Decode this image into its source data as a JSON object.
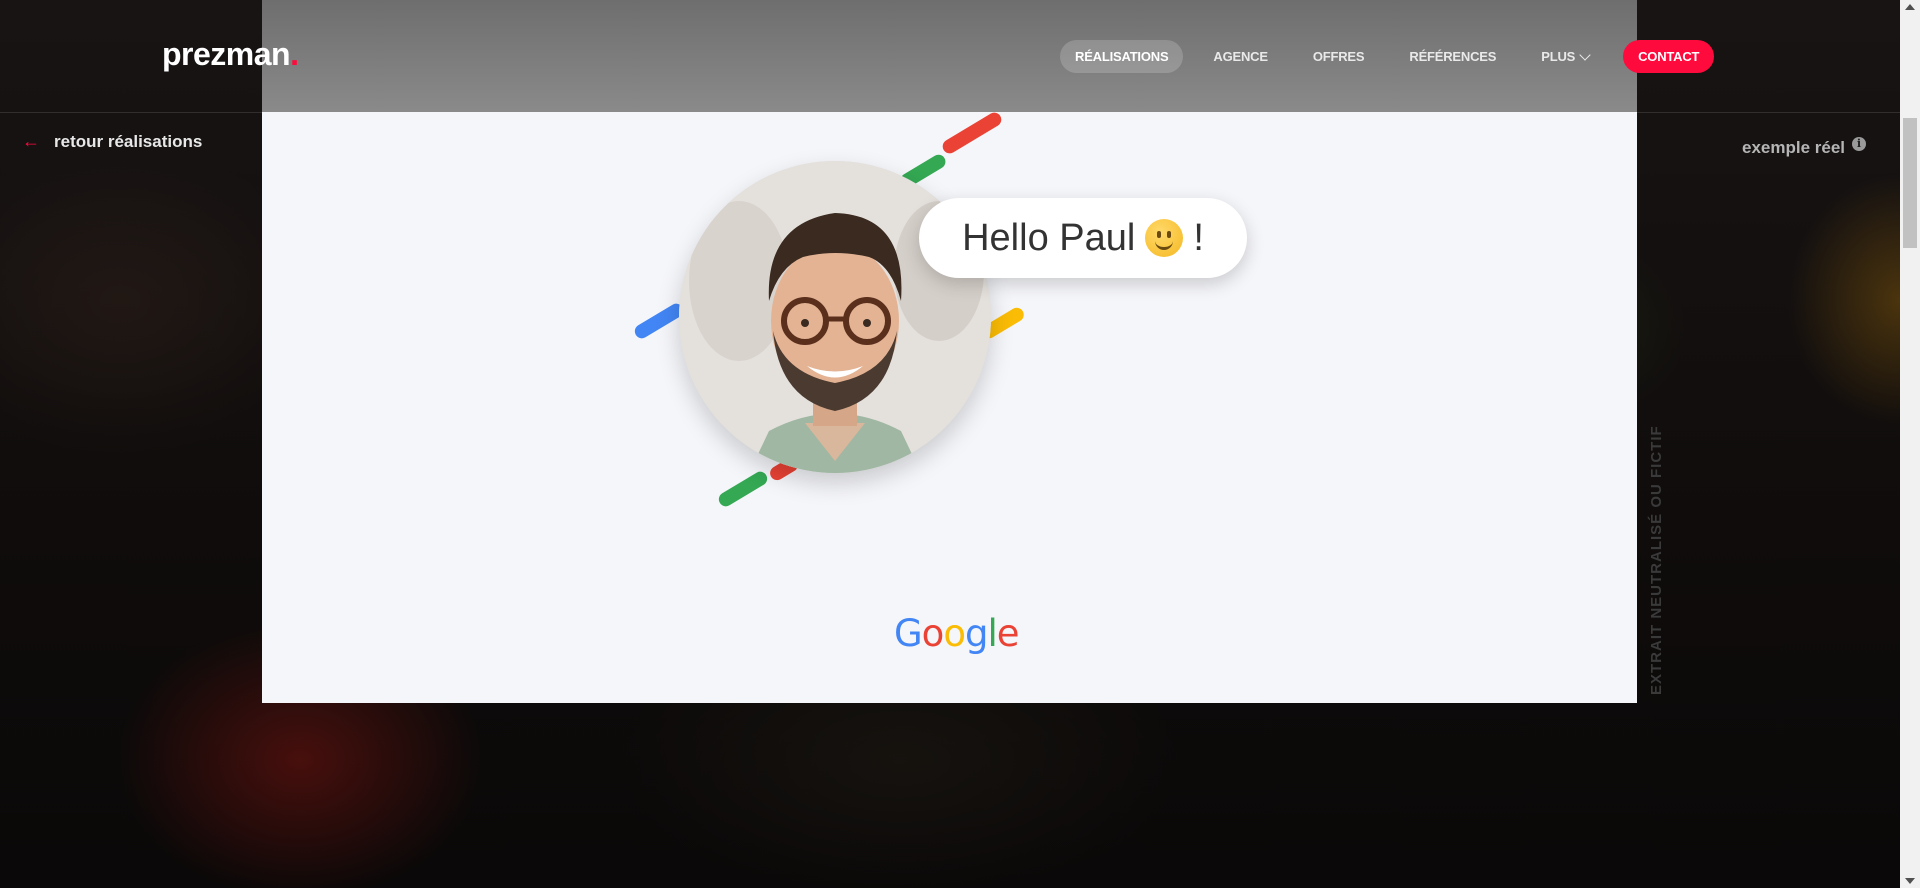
{
  "brand": {
    "name": "prezman",
    "dot": "."
  },
  "nav": {
    "items": [
      {
        "label": "RÉALISATIONS",
        "active": true
      },
      {
        "label": "AGENCE"
      },
      {
        "label": "OFFRES"
      },
      {
        "label": "RÉFÉRENCES"
      },
      {
        "label": "PLUS",
        "has_dropdown": true
      }
    ],
    "contact": "CONTACT"
  },
  "back_link": {
    "label": "retour réalisations"
  },
  "example_label": "exemple réel",
  "vertical_note": "EXTRAIT NEUTRALISÉ OU FICTIF",
  "content": {
    "greeting": "Hello Paul",
    "greeting_suffix": "!",
    "logo_text": "Google",
    "stripe_colors": [
      "#ea4335",
      "#34a853",
      "#4285f4",
      "#fbbc05"
    ]
  },
  "colors": {
    "accent": "#ff0a3c"
  }
}
